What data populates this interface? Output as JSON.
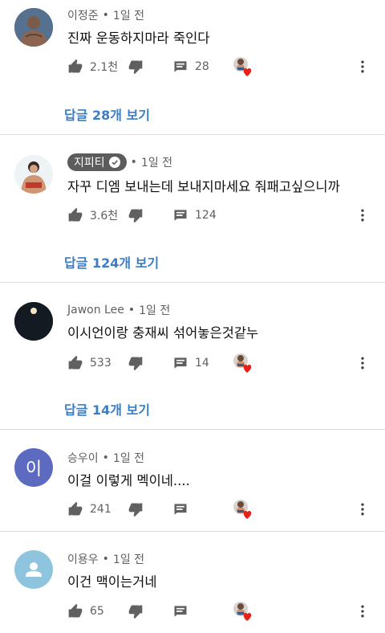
{
  "comments": [
    {
      "author": "이정준",
      "time": "1일 전",
      "text": "진짜 운동하지마라 죽인다",
      "likes": "2.1천",
      "reply_count": "28",
      "replies_link": "답글 28개 보기",
      "creator_hearted": true
    },
    {
      "author": "지피티",
      "verified": true,
      "time": "1일 전",
      "text": "자꾸 디엠 보내는데 보내지마세요 줘패고싶으니까",
      "likes": "3.6천",
      "reply_count": "124",
      "replies_link": "답글 124개 보기",
      "creator_hearted": false
    },
    {
      "author": "Jawon Lee",
      "time": "1일 전",
      "text": "이시언이랑 충재씨 섞어놓은것같누",
      "likes": "533",
      "reply_count": "14",
      "replies_link": "답글 14개 보기",
      "creator_hearted": true
    },
    {
      "author": "승우이",
      "time": "1일 전",
      "text": "이걸 이렇게 멕이네....",
      "likes": "241",
      "avatar_letter": "이",
      "creator_hearted": true
    },
    {
      "author": "이용우",
      "time": "1일 전",
      "text": "이건 맥이는거네",
      "likes": "65",
      "creator_hearted": true
    }
  ],
  "separator": "•",
  "colors": {
    "link": "#3a7ec6",
    "meta": "#606060",
    "heart": "#e62117",
    "badge": "#5c5c5c",
    "avatar_letter_bg": "#5c6bc0",
    "avatar_default_bg": "#8ec4dd"
  },
  "icons": [
    "thumb-up-icon",
    "thumb-down-icon",
    "comment-icon",
    "more-vert-icon",
    "creator-heart-icon",
    "verified-check-icon",
    "default-person-icon"
  ]
}
